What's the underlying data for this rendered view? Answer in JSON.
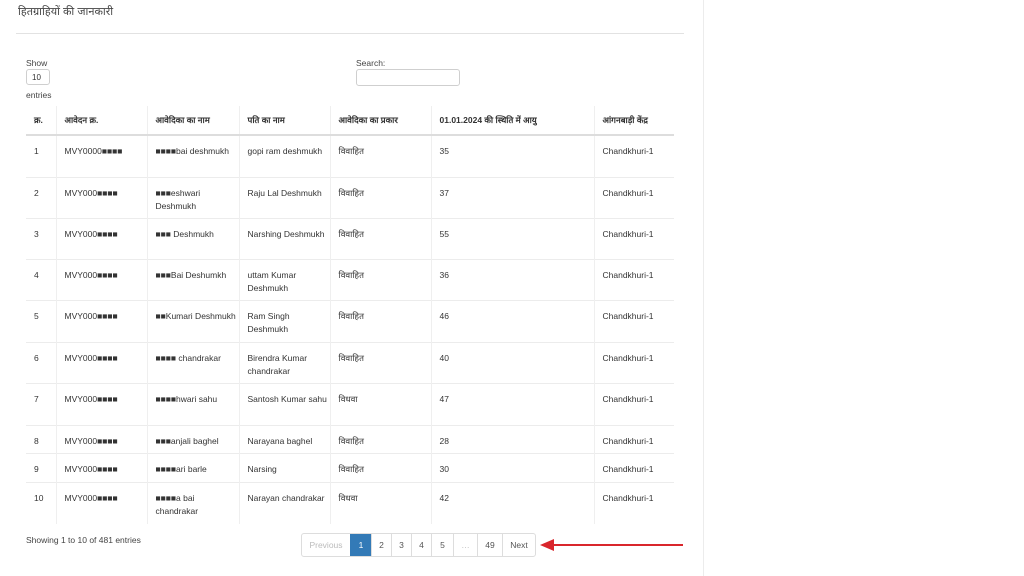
{
  "panel_title": "हितग्राहियों की जानकारी",
  "length_control": {
    "show_label": "Show",
    "value": "10",
    "entries_label": "entries"
  },
  "search": {
    "label": "Search:",
    "value": ""
  },
  "table": {
    "headers": [
      "क्र.",
      "आवेदन क्र.",
      "आवेदिका का नाम",
      "पति का नाम",
      "आवेदिका का प्रकार",
      "01.01.2024 की स्थिति में आयु",
      "आंगनबाड़ी केंद्र"
    ],
    "rows": [
      [
        "1",
        "MVY0000■■■■",
        "■■■■bai deshmukh",
        "gopi ram deshmukh",
        "विवाहित",
        "35",
        "Chandkhuri-1"
      ],
      [
        "2",
        "MVY000■■■■",
        "■■■eshwari Deshmukh",
        "Raju Lal Deshmukh",
        "विवाहित",
        "37",
        "Chandkhuri-1"
      ],
      [
        "3",
        "MVY000■■■■",
        "■■■ Deshmukh",
        "Narshing Deshmukh",
        "विवाहित",
        "55",
        "Chandkhuri-1"
      ],
      [
        "4",
        "MVY000■■■■",
        "■■■Bai Deshumkh",
        "uttam Kumar Deshmukh",
        "विवाहित",
        "36",
        "Chandkhuri-1"
      ],
      [
        "5",
        "MVY000■■■■",
        "■■Kumari Deshmukh",
        "Ram Singh Deshmukh",
        "विवाहित",
        "46",
        "Chandkhuri-1"
      ],
      [
        "6",
        "MVY000■■■■",
        "■■■■ chandrakar",
        "Birendra Kumar chandrakar",
        "विवाहित",
        "40",
        "Chandkhuri-1"
      ],
      [
        "7",
        "MVY000■■■■",
        "■■■■hwari sahu",
        "Santosh Kumar sahu",
        "विधवा",
        "47",
        "Chandkhuri-1"
      ],
      [
        "8",
        "MVY000■■■■",
        "■■■anjali baghel",
        "Narayana baghel",
        "विवाहित",
        "28",
        "Chandkhuri-1"
      ],
      [
        "9",
        "MVY000■■■■",
        "■■■■ari barle",
        "Narsing",
        "विवाहित",
        "30",
        "Chandkhuri-1"
      ],
      [
        "10",
        "MVY000■■■■",
        "■■■■a bai chandrakar",
        "Narayan chandrakar",
        "विधवा",
        "42",
        "Chandkhuri-1"
      ]
    ]
  },
  "info_text": "Showing 1 to 10 of 481 entries",
  "pagination": {
    "previous": "Previous",
    "pages": [
      "1",
      "2",
      "3",
      "4",
      "5",
      "…",
      "49"
    ],
    "active": "1",
    "next": "Next"
  },
  "annotation": {
    "arrow_color": "#d9262c",
    "meaning": "pointer-arrow-icon"
  },
  "colors": {
    "active_page": "#337ab7"
  }
}
